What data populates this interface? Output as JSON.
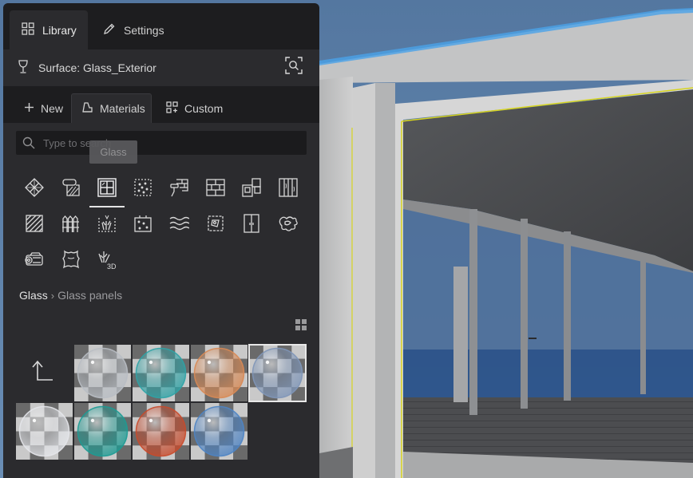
{
  "tabs": [
    {
      "label": "Library",
      "icon": "grid-icon",
      "active": true
    },
    {
      "label": "Settings",
      "icon": "pencil-icon",
      "active": false
    }
  ],
  "surface": {
    "label": "Surface: Glass_Exterior",
    "icon": "goblet-icon",
    "action_icon": "search-in-scene-icon"
  },
  "subtabs": [
    {
      "label": "New",
      "icon": "plus-icon",
      "active": false
    },
    {
      "label": "Materials",
      "icon": "material-icon",
      "active": true
    },
    {
      "label": "Custom",
      "icon": "custom-grid-icon",
      "active": false
    }
  ],
  "search": {
    "placeholder": "Type to search",
    "value": ""
  },
  "tooltip": {
    "text": "Glass"
  },
  "categories": [
    {
      "name": "tile-pattern-icon",
      "active": false
    },
    {
      "name": "wallpaper-roll-icon",
      "active": false
    },
    {
      "name": "glass-window-icon",
      "active": true
    },
    {
      "name": "speckled-surface-icon",
      "active": false
    },
    {
      "name": "paint-roller-wall-icon",
      "active": false
    },
    {
      "name": "brick-icon",
      "active": false
    },
    {
      "name": "stacked-tiles-icon",
      "active": false
    },
    {
      "name": "wood-panel-icon",
      "active": false
    },
    {
      "name": "hatched-square-icon",
      "active": false
    },
    {
      "name": "fence-icon",
      "active": false
    },
    {
      "name": "grass-ground-icon",
      "active": false
    },
    {
      "name": "dotted-panel-icon",
      "active": false
    },
    {
      "name": "water-waves-icon",
      "active": false
    },
    {
      "name": "fabric-patch-icon",
      "active": false
    },
    {
      "name": "door-panel-icon",
      "active": false
    },
    {
      "name": "stone-pattern-icon",
      "active": false
    },
    {
      "name": "log-pile-icon",
      "active": false
    },
    {
      "name": "leather-hide-icon",
      "active": false
    },
    {
      "name": "grass-3d-icon",
      "active": false
    }
  ],
  "breadcrumb": {
    "root": "Glass",
    "separator": "›",
    "leaf": "Glass panels"
  },
  "view_toggle_icon": "grid-view-icon",
  "up_icon": "up-arrow-icon",
  "materials": [
    {
      "tint": "#b9bec4",
      "selected": false
    },
    {
      "tint": "#2fa3a6",
      "selected": false
    },
    {
      "tint": "#d88a55",
      "selected": false
    },
    {
      "tint": "#7f96b8",
      "selected": true
    },
    {
      "tint": "#e4e6ea",
      "selected": false
    },
    {
      "tint": "#1d9b93",
      "selected": false
    },
    {
      "tint": "#c84a2b",
      "selected": false
    },
    {
      "tint": "#4e84c4",
      "selected": false
    }
  ]
}
